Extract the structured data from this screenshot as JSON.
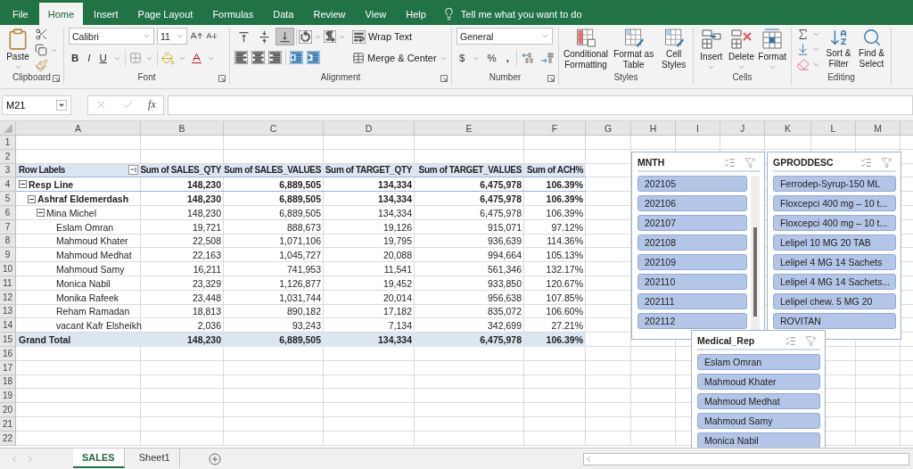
{
  "menu_tabs": [
    {
      "label": "File",
      "selected": false
    },
    {
      "label": "Home",
      "selected": true
    },
    {
      "label": "Insert",
      "selected": false
    },
    {
      "label": "Page Layout",
      "selected": false
    },
    {
      "label": "Formulas",
      "selected": false
    },
    {
      "label": "Data",
      "selected": false
    },
    {
      "label": "Review",
      "selected": false
    },
    {
      "label": "View",
      "selected": false
    },
    {
      "label": "Help",
      "selected": false
    }
  ],
  "tell_me": "Tell me what you want to do",
  "ribbon": {
    "clipboard": {
      "paste": "Paste",
      "label": "Clipboard"
    },
    "font": {
      "font_name": "Calibri",
      "font_size": "11",
      "bold": "B",
      "italic": "I",
      "underline": "U",
      "label": "Font"
    },
    "alignment": {
      "vertical_align": [
        {
          "selected": false
        },
        {
          "selected": false
        },
        {
          "selected": true
        }
      ],
      "wrap_text": "Wrap Text",
      "merge_center": "Merge & Center",
      "label": "Alignment"
    },
    "number": {
      "format": "General",
      "currency": "$",
      "percent": "%",
      "comma": ",",
      "label": "Number"
    },
    "styles": {
      "buttons": [
        "Conditional Formatting",
        "Format as Table",
        "Cell Styles"
      ],
      "label": "Styles"
    },
    "cells": {
      "buttons": [
        "Insert",
        "Delete",
        "Format"
      ],
      "label": "Cells"
    },
    "editing": {
      "buttons": [
        "Sort & Filter",
        "Find & Select"
      ],
      "label": "Editing"
    }
  },
  "formula_bar": {
    "name_box": "M21",
    "fx": "fx"
  },
  "sheet": {
    "columns": [
      "A",
      "B",
      "C",
      "D",
      "E",
      "F",
      "G",
      "H",
      "I",
      "J",
      "K",
      "L",
      "M"
    ],
    "row_numbers": [
      "1",
      "2",
      "3",
      "4",
      "5",
      "6",
      "7",
      "8",
      "9",
      "10",
      "11",
      "12",
      "13",
      "14",
      "15",
      "16",
      "17",
      "18",
      "19",
      "20",
      "21",
      "22"
    ]
  },
  "pivot": {
    "header": {
      "row_labels": "Row Labels",
      "values": [
        "Sum of SALES_QTY",
        "Sum of SALES_VALUES",
        "Sum of TARGET_QTY",
        "Sum of TARGET_VALUES",
        "Sum of ACH%"
      ]
    },
    "rows": [
      {
        "label": "Resp Line",
        "values": [
          "148,230",
          "6,889,505",
          "134,334",
          "6,475,978",
          "106.39%"
        ],
        "expanded": true,
        "children": [
          {
            "label": "Ashraf Eldemerdash",
            "values": [
              "148,230",
              "6,889,505",
              "134,334",
              "6,475,978",
              "106.39%"
            ],
            "expanded": true,
            "children": [
              {
                "label": "Mina Michel",
                "values": [
                  "148,230",
                  "6,889,505",
                  "134,334",
                  "6,475,978",
                  "106.39%"
                ],
                "expanded": true,
                "children": [
                  {
                    "label": "Eslam Omran",
                    "values": [
                      "19,721",
                      "888,673",
                      "19,126",
                      "915,071",
                      "97.12%"
                    ]
                  },
                  {
                    "label": "Mahmoud Khater",
                    "values": [
                      "22,508",
                      "1,071,106",
                      "19,795",
                      "936,639",
                      "114.36%"
                    ]
                  },
                  {
                    "label": "Mahmoud Medhat",
                    "values": [
                      "22,163",
                      "1,045,727",
                      "20,088",
                      "994,664",
                      "105.13%"
                    ]
                  },
                  {
                    "label": "Mahmoud Samy",
                    "values": [
                      "16,211",
                      "741,953",
                      "11,541",
                      "561,346",
                      "132.17%"
                    ]
                  },
                  {
                    "label": "Monica Nabil",
                    "values": [
                      "23,329",
                      "1,126,877",
                      "19,452",
                      "933,850",
                      "120.67%"
                    ]
                  },
                  {
                    "label": "Monika Rafeek",
                    "values": [
                      "23,448",
                      "1,031,744",
                      "20,014",
                      "956,638",
                      "107.85%"
                    ]
                  },
                  {
                    "label": "Reham Ramadan",
                    "values": [
                      "18,813",
                      "890,182",
                      "17,182",
                      "835,072",
                      "106.60%"
                    ]
                  },
                  {
                    "label": "vacant Kafr Elsheikh",
                    "values": [
                      "2,036",
                      "93,243",
                      "7,134",
                      "342,699",
                      "27.21%"
                    ]
                  }
                ]
              }
            ]
          }
        ]
      }
    ],
    "grand_total": {
      "label": "Grand Total",
      "values": [
        "148,230",
        "6,889,505",
        "134,334",
        "6,475,978",
        "106.39%"
      ]
    }
  },
  "slicers": [
    {
      "title": "MNTH",
      "scrollable": true,
      "items": [
        {
          "label": "202105",
          "selected": true
        },
        {
          "label": "202106",
          "selected": true
        },
        {
          "label": "202107",
          "selected": true
        },
        {
          "label": "202108",
          "selected": true
        },
        {
          "label": "202109",
          "selected": true
        },
        {
          "label": "202110",
          "selected": true
        },
        {
          "label": "202111",
          "selected": true
        },
        {
          "label": "202112",
          "selected": true
        }
      ]
    },
    {
      "title": "GPRODDESC",
      "scrollable": false,
      "items": [
        {
          "label": "Ferrodep-Syrup-150 ML",
          "selected": true
        },
        {
          "label": "Floxcepci 400 mg – 10 t...",
          "selected": true
        },
        {
          "label": "Floxcepci 400 mg – 10 t...",
          "selected": true
        },
        {
          "label": "Lelipel 10 MG 20 TAB",
          "selected": true
        },
        {
          "label": "Lelipel 4 MG 14 Sachets",
          "selected": true
        },
        {
          "label": "Lelipel 4 MG 14 Sachets...",
          "selected": true
        },
        {
          "label": "Lelipel chew. 5 MG 20",
          "selected": true
        },
        {
          "label": "ROVITAN",
          "selected": true
        }
      ]
    },
    {
      "title": "Medical_Rep",
      "scrollable": false,
      "items": [
        {
          "label": "Eslam Omran",
          "selected": true
        },
        {
          "label": "Mahmoud Khater",
          "selected": true
        },
        {
          "label": "Mahmoud Medhat",
          "selected": true
        },
        {
          "label": "Mahmoud Samy",
          "selected": true
        },
        {
          "label": "Monica Nabil",
          "selected": true
        }
      ]
    }
  ],
  "sheet_tabs": [
    {
      "label": "SALES",
      "selected": true
    },
    {
      "label": "Sheet1",
      "selected": false
    }
  ]
}
